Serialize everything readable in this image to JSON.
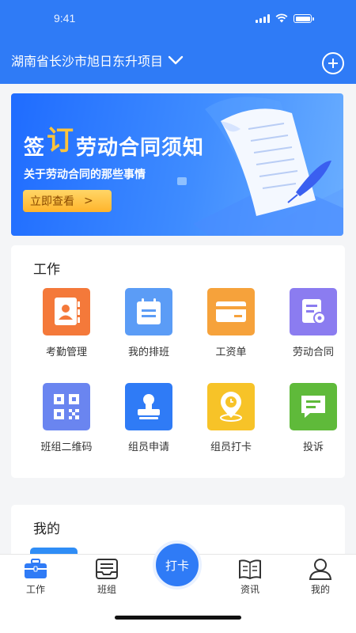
{
  "status": {
    "time": "9:41"
  },
  "header": {
    "project": "湖南省长沙市旭日东升项目"
  },
  "banner": {
    "title_prefix": "签",
    "title_highlight": "订",
    "title_suffix": "劳动合同须知",
    "subtitle": "关于劳动合同的那些事情",
    "button_label": "立即查看",
    "button_arrow": ">"
  },
  "work": {
    "title": "工作",
    "items": [
      {
        "label": "考勤管理",
        "icon": "contacts-icon",
        "color": "#f4793a"
      },
      {
        "label": "我的排班",
        "icon": "calendar-icon",
        "color": "#5b9cf6"
      },
      {
        "label": "工资单",
        "icon": "card-icon",
        "color": "#f6a23b"
      },
      {
        "label": "劳动合同",
        "icon": "contract-icon",
        "color": "#8b7cf0"
      },
      {
        "label": "班组二维码",
        "icon": "qr-code-icon",
        "color": "#6a85f0"
      },
      {
        "label": "组员申请",
        "icon": "stamp-icon",
        "color": "#2f7bf6"
      },
      {
        "label": "组员打卡",
        "icon": "location-clock-icon",
        "color": "#f7c328"
      },
      {
        "label": "投诉",
        "icon": "message-icon",
        "color": "#5fba3a"
      }
    ]
  },
  "mine": {
    "title": "我的"
  },
  "tabbar": {
    "items": [
      {
        "label": "工作",
        "icon": "briefcase-icon",
        "active": true
      },
      {
        "label": "班组",
        "icon": "inbox-icon",
        "active": false
      },
      {
        "label": "资讯",
        "icon": "news-icon",
        "active": false
      },
      {
        "label": "我的",
        "icon": "person-icon",
        "active": false
      }
    ],
    "center_label": "打卡"
  },
  "colors": {
    "primary": "#2f7bf6",
    "background": "#f4f5f7",
    "banner_button": "#ffc43b"
  }
}
